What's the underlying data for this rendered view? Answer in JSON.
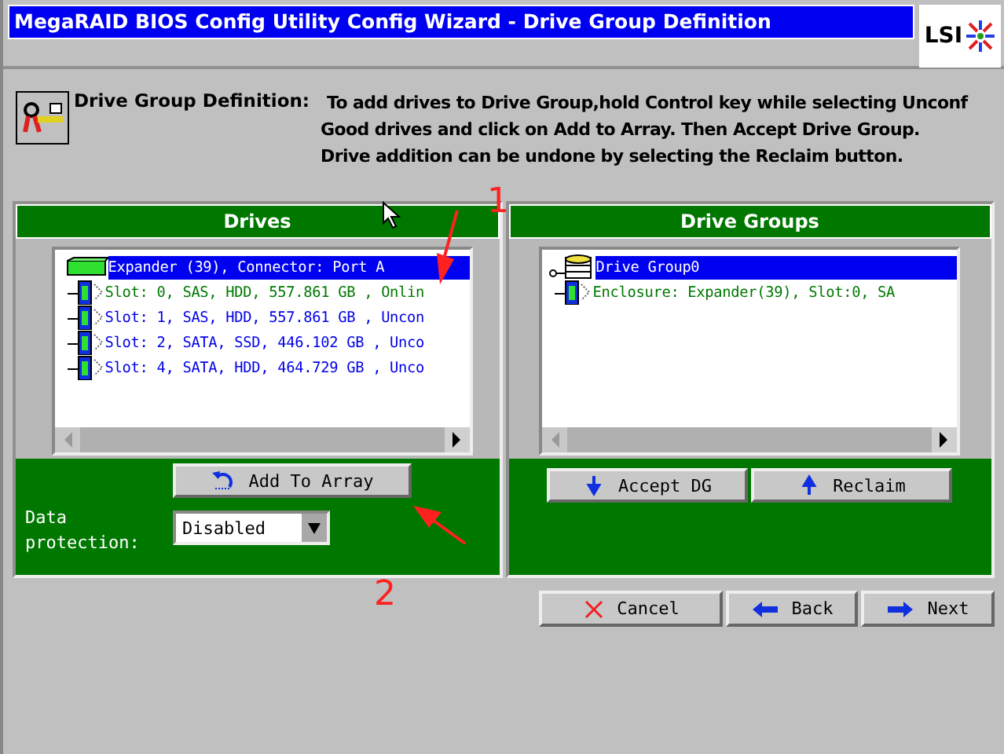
{
  "window": {
    "title": "MegaRAID BIOS Config Utility  Config Wizard - Drive Group Definition"
  },
  "logo": "LSI",
  "header": {
    "label": "Drive Group Definition:",
    "text": "To add drives to Drive Group,hold Control key while selecting Unconf Good drives and click on Add to Array. Then Accept Drive Group. Drive addition can be undone by selecting the Reclaim button."
  },
  "drives_panel": {
    "title": "Drives",
    "tree": [
      {
        "kind": "expander",
        "label": "Expander (39), Connector: Port A",
        "selected": true,
        "children": [
          {
            "kind": "drive",
            "label": "Slot: 0, SAS, HDD, 557.861 GB , Onlin",
            "selected": false,
            "color": "#007800"
          },
          {
            "kind": "drive",
            "label": "Slot: 1, SAS, HDD, 557.861 GB , Uncon",
            "selected": false,
            "color": "#0000e8"
          },
          {
            "kind": "drive",
            "label": "Slot: 2, SATA, SSD, 446.102 GB , Unco",
            "selected": false,
            "color": "#0000e8"
          },
          {
            "kind": "drive",
            "label": "Slot: 4, SATA, HDD, 464.729 GB , Unco",
            "selected": false,
            "color": "#0000e8"
          }
        ]
      }
    ],
    "add_button": "Add To Array",
    "protection_label": "Data protection:",
    "protection_value": "Disabled"
  },
  "groups_panel": {
    "title": "Drive Groups",
    "tree": [
      {
        "kind": "group",
        "label": "Drive Group0",
        "selected": true,
        "children": [
          {
            "kind": "drive",
            "label": "Enclosure: Expander(39), Slot:0, SA",
            "selected": false,
            "color": "#007800"
          }
        ]
      }
    ],
    "buttons": [
      {
        "kind": "down",
        "label": "Accept DG"
      },
      {
        "kind": "up",
        "label": "Reclaim"
      }
    ]
  },
  "nav_buttons": [
    {
      "kind": "cancel",
      "label": "Cancel"
    },
    {
      "kind": "back",
      "label": "Back"
    },
    {
      "kind": "next",
      "label": "Next"
    }
  ],
  "annotations": [
    {
      "label": "1"
    },
    {
      "label": "2"
    }
  ]
}
